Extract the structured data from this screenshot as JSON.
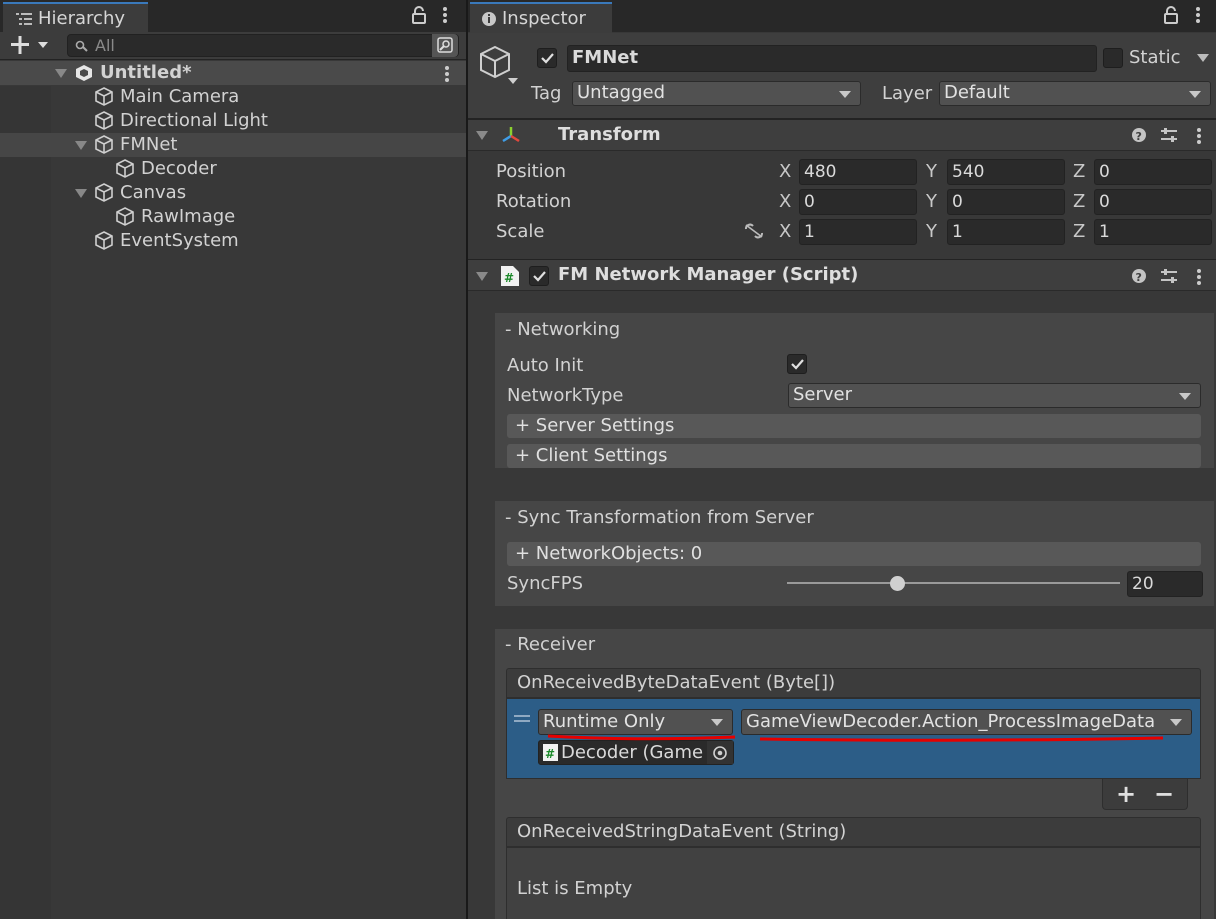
{
  "hierarchy": {
    "tab_label": "Hierarchy",
    "search_placeholder": "All",
    "scene": "Untitled*",
    "items": [
      {
        "label": "Main Camera"
      },
      {
        "label": "Directional Light"
      },
      {
        "label": "FMNet"
      },
      {
        "label": "Decoder"
      },
      {
        "label": "Canvas"
      },
      {
        "label": "RawImage"
      },
      {
        "label": "EventSystem"
      }
    ]
  },
  "inspector": {
    "tab_label": "Inspector",
    "object_name": "FMNet",
    "static_label": "Static",
    "tag_label": "Tag",
    "tag_value": "Untagged",
    "layer_label": "Layer",
    "layer_value": "Default",
    "transform": {
      "title": "Transform",
      "rows": [
        {
          "label": "Position",
          "x": "480",
          "y": "540",
          "z": "0"
        },
        {
          "label": "Rotation",
          "x": "0",
          "y": "0",
          "z": "0"
        },
        {
          "label": "Scale",
          "x": "1",
          "y": "1",
          "z": "1"
        }
      ],
      "axis_x": "X",
      "axis_y": "Y",
      "axis_z": "Z"
    },
    "script": {
      "title": "FM Network Manager (Script)",
      "networking": {
        "header": "- Networking",
        "auto_init_label": "Auto Init",
        "auto_init_checked": true,
        "network_type_label": "NetworkType",
        "network_type_value": "Server",
        "server_settings": "+ Server Settings",
        "client_settings": "+ Client Settings"
      },
      "sync": {
        "header": "- Sync Transformation from Server",
        "network_objects": "+ NetworkObjects: 0",
        "sync_fps_label": "SyncFPS",
        "sync_fps_value": "20",
        "sync_fps_fraction": 0.33
      },
      "receiver": {
        "header": "- Receiver",
        "byte_event": {
          "title": "OnReceivedByteDataEvent (Byte[])",
          "runtime_mode": "Runtime Only",
          "function": "GameViewDecoder.Action_ProcessImageData",
          "target_object": "Decoder (Game ’"
        },
        "add_symbol": "+",
        "remove_symbol": "−",
        "string_event": {
          "title": "OnReceivedStringDataEvent (String)",
          "empty_text": "List is Empty"
        }
      }
    }
  },
  "colors": {
    "panel": "#383838",
    "tab_bar": "#282828",
    "selection_blue": "#2c5d87",
    "annotation_red": "#e60000"
  },
  "icons": [
    "hierarchy-list-icon",
    "lock-icon",
    "kebab-menu-icon",
    "plus-icon",
    "search-icon",
    "gameobject-cube-icon",
    "unity-scene-icon",
    "info-icon",
    "transform-axes-icon",
    "help-icon",
    "presets-icon",
    "script-icon",
    "link-constrain-icon",
    "object-picker-icon"
  ]
}
